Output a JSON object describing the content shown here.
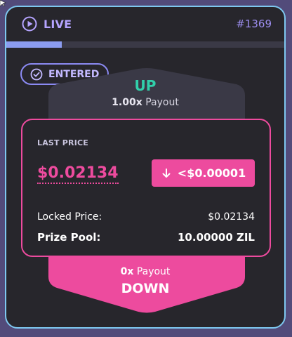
{
  "header": {
    "status_label": "LIVE",
    "epoch": "#1369",
    "progress": 0.2
  },
  "badge": {
    "label": "ENTERED"
  },
  "up": {
    "label": "UP",
    "multiplier": "1.00x",
    "payout_label": "Payout"
  },
  "panel": {
    "last_price_title": "LAST PRICE",
    "last_price_value": "$0.02134",
    "change_value": "<$0.00001",
    "locked_label": "Locked Price:",
    "locked_value": "$0.02134",
    "pool_label": "Prize Pool:",
    "pool_value": "10.00000 ZIL"
  },
  "down": {
    "multiplier": "0x",
    "payout_label": "Payout",
    "label": "DOWN"
  },
  "colors": {
    "background": "#524b7a",
    "card": "#27262c",
    "card_border": "#7ec8f0",
    "up": "#31d0aa",
    "down": "#ed4b9e",
    "accent": "#b5a4ff"
  },
  "icons": {
    "status": "play-circle-icon",
    "badge": "check-circle-icon",
    "change": "arrow-down-icon",
    "cursor": "mouse-cursor-icon"
  }
}
